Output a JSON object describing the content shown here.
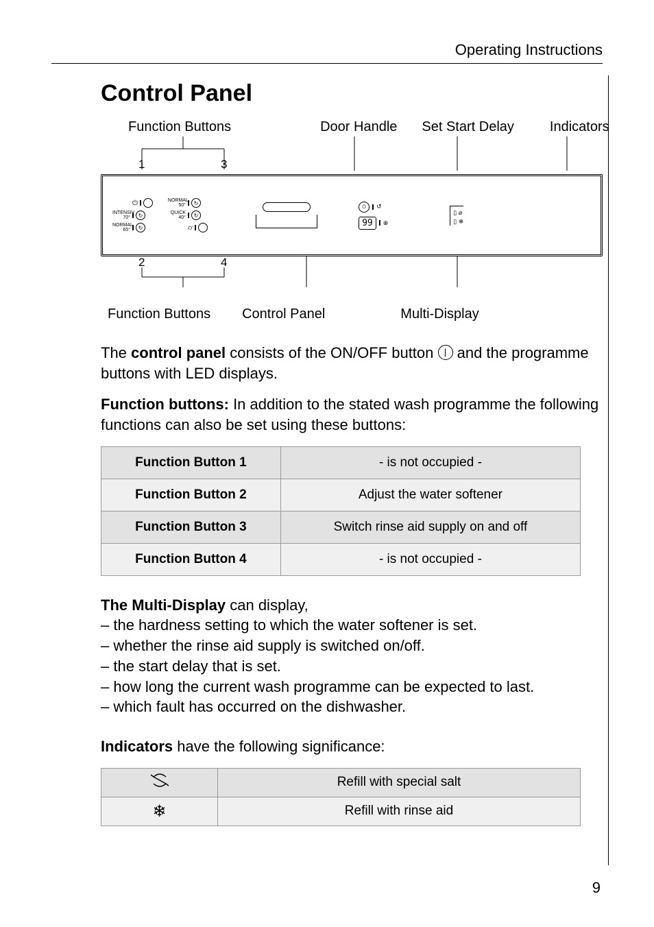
{
  "header": "Operating Instructions",
  "section_title": "Control Panel",
  "labels": {
    "top": {
      "function_buttons": "Function Buttons",
      "door_handle": "Door Handle",
      "set_start_delay": "Set Start Delay",
      "indicators": "Indicators"
    },
    "bottom": {
      "function_buttons": "Function Buttons",
      "control_panel": "Control Panel",
      "multi_display": "Multi-Display"
    },
    "nums": {
      "n1": "1",
      "n2": "2",
      "n3": "3",
      "n4": "4"
    }
  },
  "panel": {
    "col1": [
      "",
      "INTENSIV 70°",
      "NORMAL 65°"
    ],
    "col2": [
      "NORMAL 50°",
      "QUICK 40°",
      ""
    ],
    "digits": "99",
    "ind_icons": [
      "⟲ ⌀",
      "⟲ ❄"
    ]
  },
  "para1a": "The ",
  "para1b": "control panel",
  "para1c": " consists of the ON/OFF button ",
  "para1d": " and the programme buttons with LED displays.",
  "para2a": "Function buttons:",
  "para2b": " In addition to the stated wash programme the following functions can also be set using these buttons:",
  "func_table": [
    {
      "btn": "Function Button 1",
      "desc": "- is not occupied -"
    },
    {
      "btn": "Function Button 2",
      "desc": "Adjust the water softener"
    },
    {
      "btn": "Function Button 3",
      "desc": "Switch rinse aid supply on and off"
    },
    {
      "btn": "Function Button 4",
      "desc": "- is not occupied -"
    }
  ],
  "multi_title_a": "The Multi-Display",
  "multi_title_b": " can display,",
  "multi_items": [
    "– the hardness setting to which the water softener is set.",
    "– whether the rinse aid supply is switched on/off.",
    "– the start delay that is set.",
    "– how long the current wash programme can be expected to last.",
    "– which fault has occurred on the dishwasher."
  ],
  "ind_title_a": "Indicators",
  "ind_title_b": " have the following significance:",
  "ind_table": [
    {
      "icon": "salt-s-icon",
      "desc": "Refill with special salt"
    },
    {
      "icon": "snowflake-icon",
      "desc": "Refill with rinse aid"
    }
  ],
  "page_number": "9"
}
